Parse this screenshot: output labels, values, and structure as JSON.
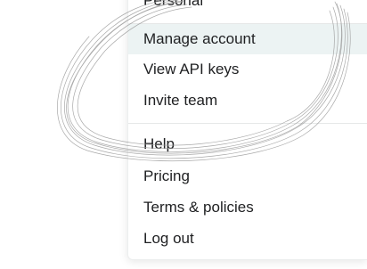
{
  "menu": {
    "partial_item_label": "Personal",
    "account_items": [
      {
        "label": "Manage account"
      },
      {
        "label": "View API keys"
      },
      {
        "label": "Invite team"
      }
    ],
    "help_items": [
      {
        "label": "Help"
      },
      {
        "label": "Pricing"
      },
      {
        "label": "Terms & policies"
      },
      {
        "label": "Log out"
      }
    ],
    "highlighted_item": "Manage account"
  },
  "colors": {
    "text": "#202123",
    "highlight": "#ecf3f3",
    "annotation_stroke": "#9b9b9b"
  }
}
